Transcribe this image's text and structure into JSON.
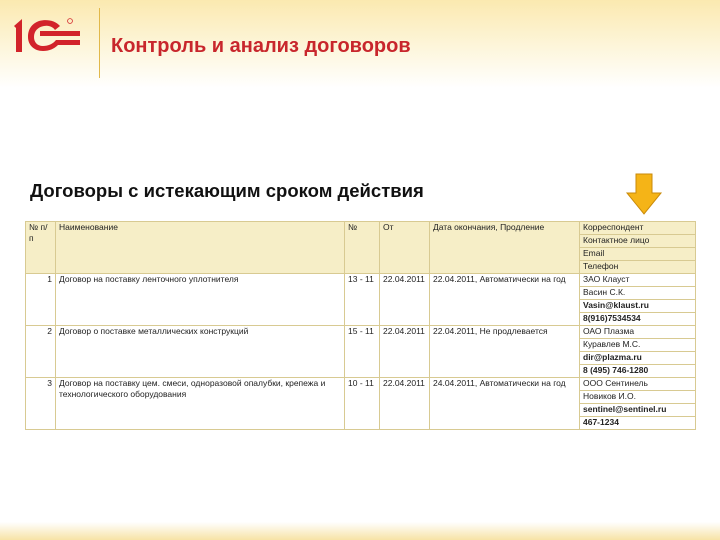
{
  "header": {
    "logo_text": "1С",
    "title": "Контроль и анализ договоров",
    "accent_color": "#c8262c",
    "logo_color": "#d2232a"
  },
  "report": {
    "title": "Договоры с истекающим сроком действия",
    "arrow_color": "#f5b417",
    "arrow_icon": "down-arrow-icon",
    "columns": [
      "№ п/п",
      "Наименование",
      "№",
      "От",
      "Дата окончания, Продление"
    ],
    "contact_headers": [
      "Корреспондент",
      "Контактное лицо",
      "Email",
      "Телефон"
    ],
    "rows": [
      {
        "n": "1",
        "name": "Договор на поставку ленточного уплотнителя",
        "number": "13 - 11",
        "date": "22.04.2011",
        "end": "22.04.2011, Автоматически на год",
        "contacts": [
          "ЗАО Клауст",
          "Васин С.К.",
          "Vasin@klaust.ru",
          "8(916)7534534"
        ]
      },
      {
        "n": "2",
        "name": "Договор о поставке металлических конструкций",
        "number": "15 - 11",
        "date": "22.04.2011",
        "end": "22.04.2011, Не продлевается",
        "contacts": [
          "ОАО Плазма",
          "Куравлев М.С.",
          "dir@plazma.ru",
          "8 (495) 746-1280"
        ]
      },
      {
        "n": "3",
        "name": "Договор на поставку цем. смеси, одноразовой опалубки, крепежа и технологического оборудования",
        "number": "10 - 11",
        "date": "22.04.2011",
        "end": "24.04.2011, Автоматически на год",
        "contacts": [
          "ООО Сентинель",
          "Новиков И.О.",
          "sentinel@sentinel.ru",
          "467-1234"
        ]
      }
    ]
  }
}
